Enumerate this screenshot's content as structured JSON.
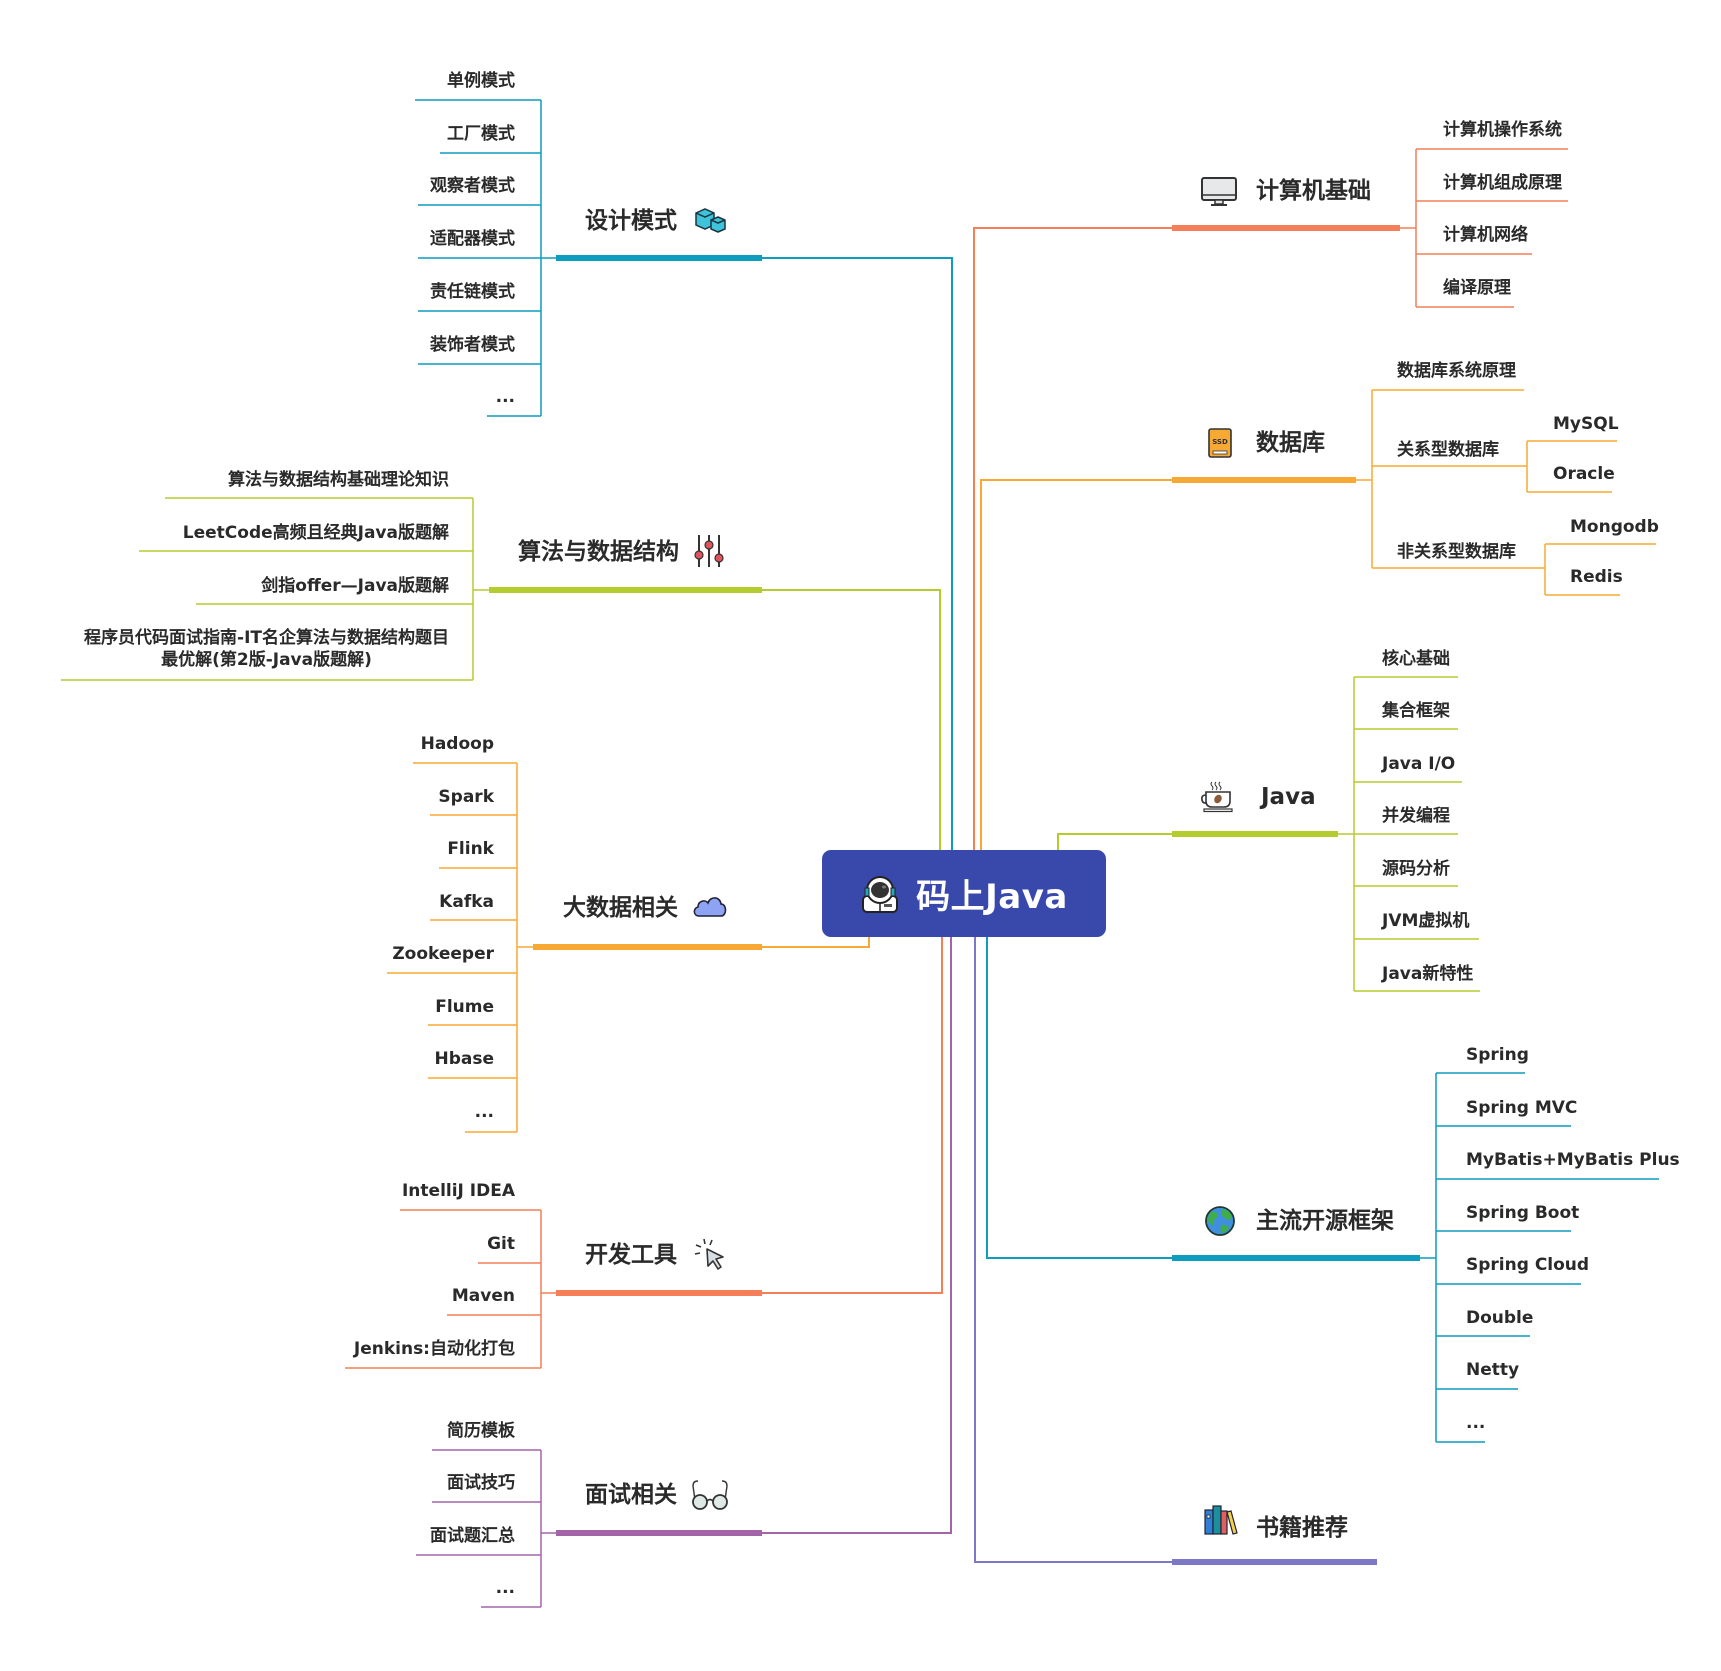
{
  "root": {
    "title": "码上Java",
    "icon": "astronaut-icon",
    "color": "#3949ab"
  },
  "branches": {
    "design": {
      "label": "设计模式",
      "icon": "cubes-icon",
      "color": "#0e9cbf",
      "children": [
        "单例模式",
        "工厂模式",
        "观察者模式",
        "适配器模式",
        "责任链模式",
        "装饰者模式",
        "..."
      ]
    },
    "algo": {
      "label": "算法与数据结构",
      "icon": "sliders-icon",
      "color": "#b5cc2e",
      "children": [
        "算法与数据结构基础理论知识",
        "LeetCode高频且经典Java版题解",
        "剑指offer—Java版题解",
        "程序员代码面试指南-IT名企算法与数据结构题目",
        "最优解(第2版-Java版题解)"
      ]
    },
    "bigdata": {
      "label": "大数据相关",
      "icon": "cloud-icon",
      "color": "#f7a934",
      "children": [
        "Hadoop",
        "Spark",
        "Flink",
        "Kafka",
        "Zookeeper",
        "Flume",
        "Hbase",
        "..."
      ]
    },
    "tools": {
      "label": "开发工具",
      "icon": "cursor-click-icon",
      "color": "#f47f58",
      "children": [
        "IntelliJ IDEA",
        "Git",
        "Maven",
        "Jenkins:自动化打包"
      ]
    },
    "interview": {
      "label": "面试相关",
      "icon": "glasses-icon",
      "color": "#a465a8",
      "children": [
        "简历模板",
        "面试技巧",
        "面试题汇总",
        "..."
      ]
    },
    "cs": {
      "label": "计算机基础",
      "icon": "monitor-icon",
      "color": "#f47f58",
      "children": [
        "计算机操作系统",
        "计算机组成原理",
        "计算机网络",
        "编译原理"
      ]
    },
    "db": {
      "label": "数据库",
      "icon": "ssd-icon",
      "color": "#f7a934",
      "children": [
        "数据库系统原理",
        "关系型数据库",
        "非关系型数据库"
      ],
      "relational": [
        "MySQL",
        "Oracle"
      ],
      "nonrelational": [
        "Mongodb",
        "Redis"
      ]
    },
    "java": {
      "label": "Java",
      "icon": "coffee-cup-icon",
      "color": "#b5cc2e",
      "children": [
        "核心基础",
        "集合框架",
        "Java I/O",
        "并发编程",
        "源码分析",
        "JVM虚拟机",
        "Java新特性"
      ]
    },
    "frameworks": {
      "label": "主流开源框架",
      "icon": "globe-icon",
      "color": "#0e9cbf",
      "children": [
        "Spring",
        "Spring MVC",
        "MyBatis+MyBatis Plus",
        "Spring Boot",
        "Spring Cloud",
        "Double",
        "Netty",
        "..."
      ]
    },
    "books": {
      "label": "书籍推荐",
      "icon": "books-icon",
      "color": "#7b78c6"
    }
  }
}
